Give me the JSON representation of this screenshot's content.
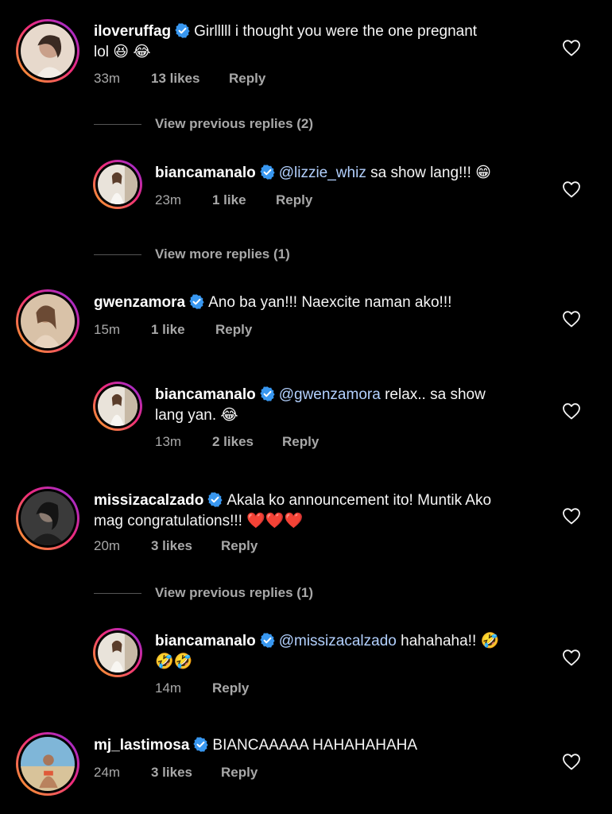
{
  "comments": [
    {
      "username": "iloveruffag",
      "text": "Girlllll i thought you were the one pregnant",
      "text2": "lol 😆 😂",
      "time": "33m",
      "likes": "13 likes",
      "reply": "Reply"
    },
    {
      "view": "View previous replies (2)"
    },
    {
      "username": "biancamanalo",
      "mention": "@lizzie_whiz",
      "text": "sa show lang!!! 😁",
      "time": "23m",
      "likes": "1 like",
      "reply": "Reply"
    },
    {
      "view": "View more replies (1)"
    },
    {
      "username": "gwenzamora",
      "text": "Ano ba yan!!! Naexcite naman ako!!!",
      "time": "15m",
      "likes": "1 like",
      "reply": "Reply"
    },
    {
      "username": "biancamanalo",
      "mention": "@gwenzamora",
      "text": "relax.. sa show",
      "text2": "lang yan. 😂",
      "time": "13m",
      "likes": "2 likes",
      "reply": "Reply"
    },
    {
      "username": "missizacalzado",
      "text": "Akala ko announcement ito! Muntik Ako",
      "text2": "mag congratulations!!! ❤️❤️❤️",
      "time": "20m",
      "likes": "3 likes",
      "reply": "Reply"
    },
    {
      "view": "View previous replies (1)"
    },
    {
      "username": "biancamanalo",
      "mention": "@missizacalzado",
      "text": "hahahaha!! 🤣",
      "text2": "🤣🤣",
      "time": "14m",
      "reply": "Reply"
    },
    {
      "username": "mj_lastimosa",
      "text": "BIANCAAAAA HAHAHAHAHA",
      "time": "24m",
      "likes": "3 likes",
      "reply": "Reply"
    }
  ],
  "colors": {
    "verified": "#3897f0",
    "mention": "#b3d1ff",
    "meta": "#a8a8a8"
  }
}
